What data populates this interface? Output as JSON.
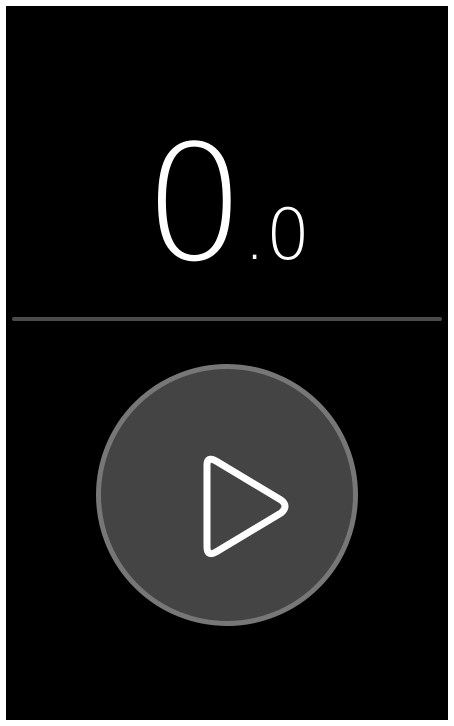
{
  "timer": {
    "whole": "0",
    "fraction": ".0"
  },
  "controls": {
    "play_icon": "play-icon"
  },
  "colors": {
    "background": "#000000",
    "text": "#ffffff",
    "divider": "#4a4a4a",
    "button_fill": "#444444",
    "button_border": "#777777"
  }
}
